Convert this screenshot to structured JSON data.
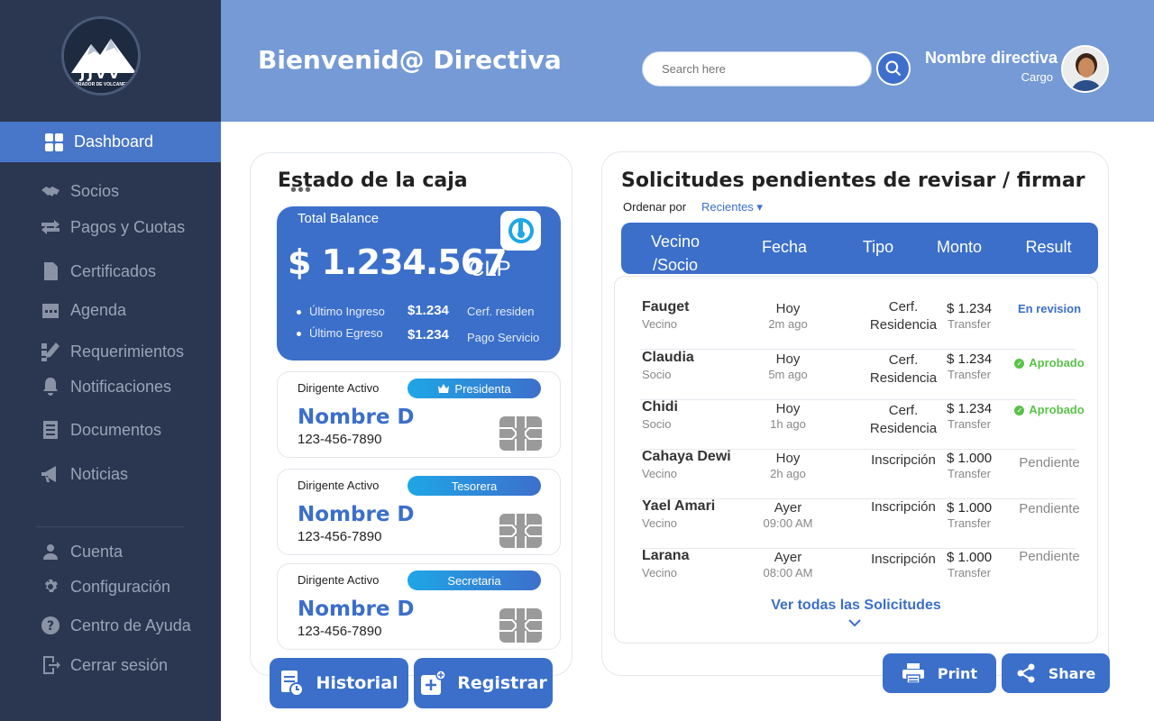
{
  "sidebar": {
    "logo": {
      "title": "JJVV",
      "subtitle": "MIRADOR DE VOLCANES"
    },
    "active_item": "Dashboard",
    "items": [
      "Socios",
      "Pagos y Cuotas",
      "Certificados",
      "Agenda",
      "Requerimientos",
      "Notificaciones",
      "Documentos",
      "Noticias"
    ],
    "bottom_items": [
      "Cuenta",
      "Configuración",
      "Centro de Ayuda",
      "Cerrar sesión"
    ]
  },
  "header": {
    "welcome": "Bienvenid@ Directiva",
    "search_placeholder": "Search here",
    "user_name": "Nombre directiva",
    "user_role": "Cargo"
  },
  "caja": {
    "title": "Estado de la caja",
    "more": "•••",
    "balance_label": "Total Balance",
    "balance_amount": "$ 1.234.567",
    "currency": "CLP",
    "ingreso_label": "Último Ingreso",
    "ingreso_value": "$1.234",
    "ingreso_desc": "Cerf. residen",
    "egreso_label": "Último Egreso",
    "egreso_value": "$1.234",
    "egreso_desc": "Pago Servicio",
    "dirigentes": [
      {
        "label": "Dirigente Activo",
        "role": "Presidenta",
        "name": "Nombre D",
        "phone": "123-456-7890"
      },
      {
        "label": "Dirigente Activo",
        "role": "Tesorera",
        "name": "Nombre D",
        "phone": "123-456-7890"
      },
      {
        "label": "Dirigente Activo",
        "role": "Secretaria",
        "name": "Nombre D",
        "phone": "123-456-7890"
      }
    ],
    "historial_label": "Historial",
    "registrar_label": "Registrar"
  },
  "solicitudes": {
    "title": "Solicitudes pendientes de revisar / firmar",
    "sort_label": "Ordenar por",
    "sort_value": "Recientes ▾",
    "columns": {
      "vecino_line1": "Vecino",
      "vecino_line2": "/Socio",
      "fecha": "Fecha",
      "tipo": "Tipo",
      "monto": "Monto",
      "result": "Result"
    },
    "rows": [
      {
        "name": "Fauget",
        "type": "Vecino",
        "day": "Hoy",
        "ago": "2m ago",
        "tipo1": "Cerf.",
        "tipo2": "Residencia",
        "amount": "$ 1.234",
        "transfer": "Transfer",
        "result": "En revision",
        "status": "review"
      },
      {
        "name": "Claudia",
        "type": "Socio",
        "day": "Hoy",
        "ago": "5m ago",
        "tipo1": "Cerf.",
        "tipo2": "Residencia",
        "amount": "$ 1.234",
        "transfer": "Transfer",
        "result": "Aprobado",
        "status": "ok"
      },
      {
        "name": "Chidi",
        "type": "Socio",
        "day": "Hoy",
        "ago": "1h ago",
        "tipo1": "Cerf.",
        "tipo2": "Residencia",
        "amount": "$ 1.234",
        "transfer": "Transfer",
        "result": "Aprobado",
        "status": "ok"
      },
      {
        "name": "Cahaya Dewi",
        "type": "Vecino",
        "day": "Hoy",
        "ago": "2h ago",
        "tipo1": "Inscripción",
        "tipo2": "",
        "amount": "$ 1.000",
        "transfer": "Transfer",
        "result": "Pendiente",
        "status": "pending"
      },
      {
        "name": "Yael Amari",
        "type": "Vecino",
        "day": "Ayer",
        "ago": "09:00 AM",
        "tipo1": "Inscripción",
        "tipo2": "",
        "amount": "$ 1.000",
        "transfer": "Transfer",
        "result": "Pendiente",
        "status": "pending"
      },
      {
        "name": "Larana",
        "type": "Vecino",
        "day": "Ayer",
        "ago": "08:00 AM",
        "tipo1": "Inscripción",
        "tipo2": "",
        "amount": "$ 1.000",
        "transfer": "Transfer",
        "result": "Pendiente",
        "status": "pending"
      }
    ],
    "view_all": "Ver todas las Solicitudes"
  },
  "actions": {
    "print": "Print",
    "share": "Share"
  },
  "colors": {
    "sidebar": "#2b3750",
    "header": "#759ad5",
    "accent": "#3b6fca",
    "approved": "#5ac24a"
  }
}
